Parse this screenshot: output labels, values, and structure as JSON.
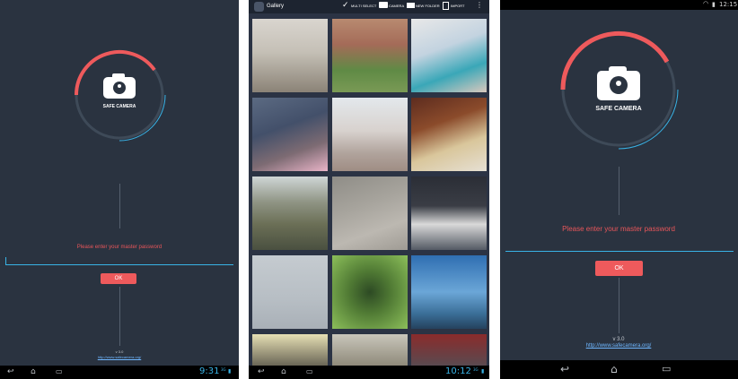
{
  "login_small": {
    "app_name": "SAFE CAMERA",
    "prompt": "Please enter your master password",
    "ok_label": "OK",
    "version": "v 3.0",
    "url": "http://www.safecamera.org/",
    "clock": "9:31",
    "status_tiny": "3G"
  },
  "gallery": {
    "title": "Gallery",
    "actions": [
      "MULTI SELECT",
      "CAMERA",
      "NEW FOLDER",
      "IMPORT"
    ],
    "clock": "10:12",
    "status_tiny": "3G"
  },
  "login_large": {
    "app_name": "SAFE CAMERA",
    "prompt": "Please enter your master password",
    "ok_label": "OK",
    "version": "v 3.0",
    "url": "http://www.safecamera.org/",
    "status_clock": "12:15"
  },
  "colors": {
    "background": "#2a3340",
    "accent_red": "#ee5a5c",
    "accent_blue": "#39b3e6"
  },
  "icons": [
    "camera-lock-icon",
    "back-icon",
    "home-icon",
    "recents-icon",
    "checkmark-icon",
    "camera-icon",
    "folder-icon",
    "import-icon",
    "overflow-menu-icon",
    "wifi-icon",
    "battery-icon"
  ]
}
